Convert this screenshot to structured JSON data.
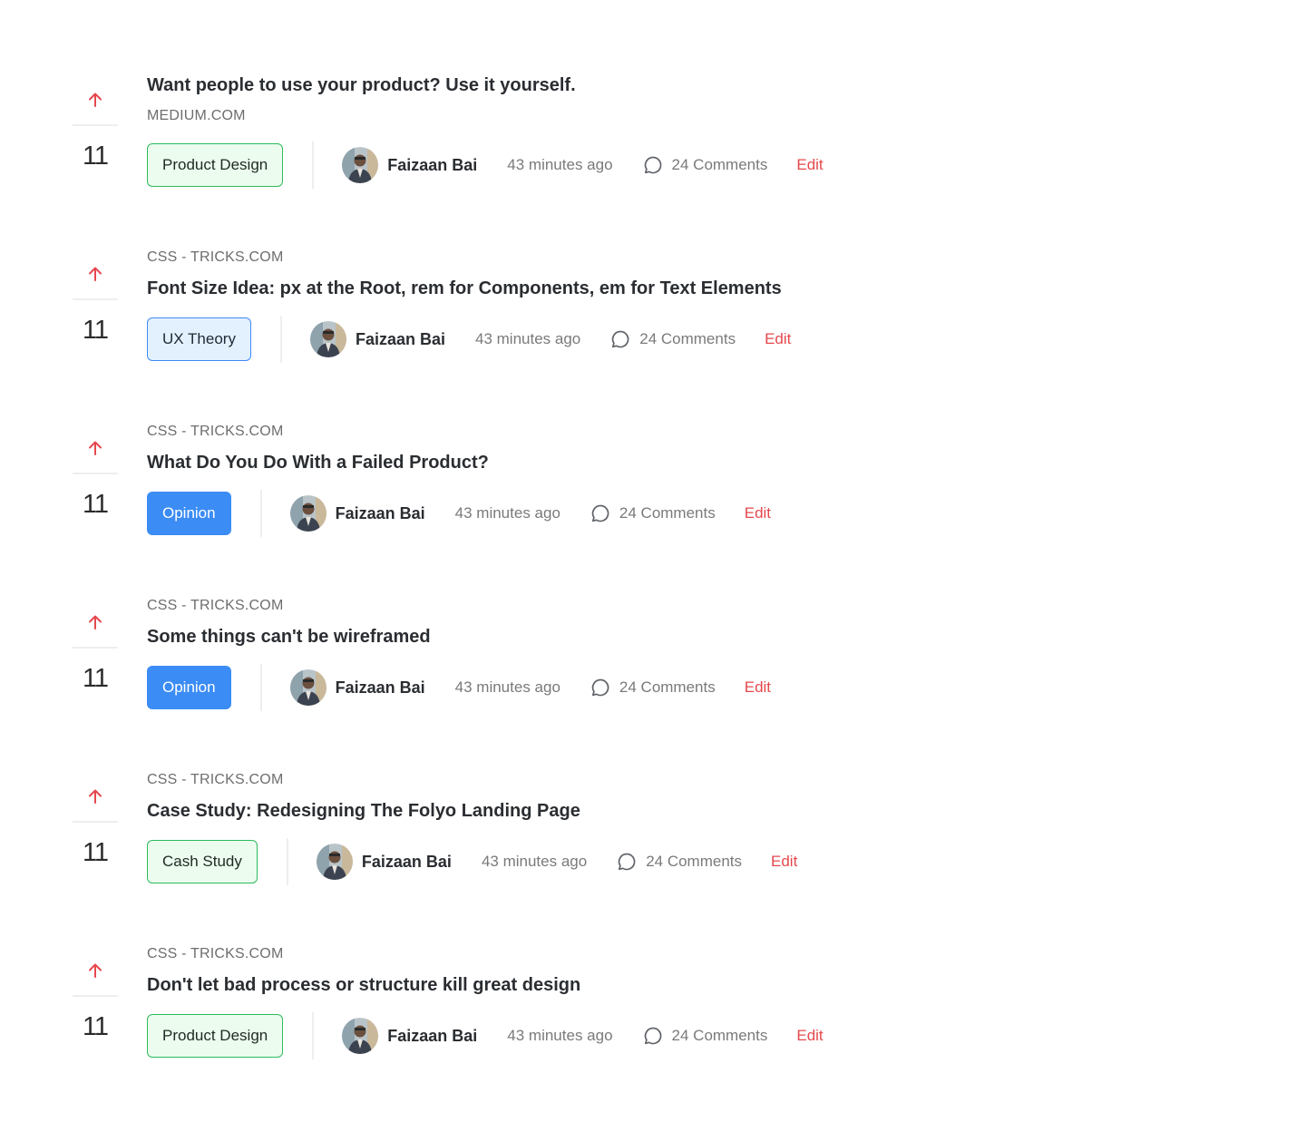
{
  "posts": [
    {
      "votes": "11",
      "source": "MEDIUM.COM",
      "title": "Want people to use your product? Use it yourself.",
      "tag": "Product Design",
      "tag_style": "green",
      "author": "Faizaan Bai",
      "time": "43 minutes ago",
      "comments": "24 Comments",
      "edit": "Edit"
    },
    {
      "votes": "11",
      "source": "CSS - TRICKS.COM",
      "title": "Font Size Idea: px at the Root, rem for Components, em for Text Elements",
      "tag": "UX Theory",
      "tag_style": "blue-light",
      "author": "Faizaan Bai",
      "time": "43 minutes ago",
      "comments": "24 Comments",
      "edit": "Edit"
    },
    {
      "votes": "11",
      "source": "CSS - TRICKS.COM",
      "title": "What Do You Do With a Failed Product?",
      "tag": "Opinion",
      "tag_style": "blue",
      "author": "Faizaan Bai",
      "time": "43 minutes ago",
      "comments": "24 Comments",
      "edit": "Edit"
    },
    {
      "votes": "11",
      "source": "CSS - TRICKS.COM",
      "title": "Some things can't be wireframed",
      "tag": "Opinion",
      "tag_style": "blue",
      "author": "Faizaan Bai",
      "time": "43 minutes ago",
      "comments": "24 Comments",
      "edit": "Edit"
    },
    {
      "votes": "11",
      "source": "CSS - TRICKS.COM",
      "title": "Case Study: Redesigning The Folyo Landing Page",
      "tag": "Cash Study",
      "tag_style": "green",
      "author": "Faizaan Bai",
      "time": "43 minutes ago",
      "comments": "24 Comments",
      "edit": "Edit"
    },
    {
      "votes": "11",
      "source": "CSS - TRICKS.COM",
      "title": "Don't let bad process or structure kill great design",
      "tag": "Product Design",
      "tag_style": "green",
      "author": "Faizaan Bai",
      "time": "43 minutes ago",
      "comments": "24 Comments",
      "edit": "Edit"
    }
  ],
  "icons": {
    "upvote": "upvote-arrow-icon",
    "comment": "comment-bubble-icon"
  },
  "colors": {
    "upvote": "#e5484d",
    "edit": "#e5484d",
    "tag_green_border": "#2dbb5a",
    "tag_green_bg": "#ecfcef",
    "tag_blue": "#3b8cf5",
    "tag_blue_light_bg": "#e3f1ff"
  }
}
